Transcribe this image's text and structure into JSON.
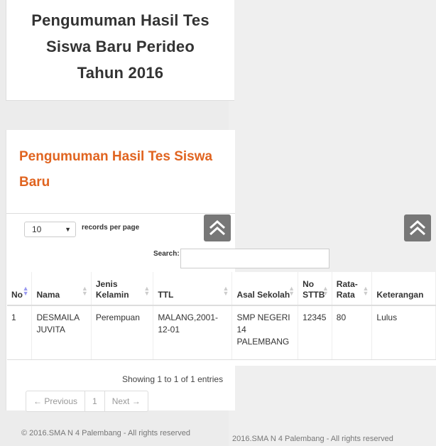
{
  "title_card": {
    "lines": [
      "Pengumuman Hasil Tes",
      "Siswa Baru Perideo",
      "Tahun 2016"
    ]
  },
  "main": {
    "heading_lines": [
      "Pengumuman Hasil Tes Siswa",
      "Baru"
    ],
    "records": {
      "value": "10",
      "label": "records per page"
    },
    "search_label": "Search:",
    "table": {
      "columns": [
        "No",
        "Nama",
        "Jenis Kelamin",
        "TTL",
        "Asal Sekolah",
        "No STTB",
        "Rata-Rata",
        "Keterangan"
      ],
      "rows": [
        [
          "1",
          "DESMAILA JUVITA",
          "Perempuan",
          "MALANG,2001-12-01",
          "SMP NEGERI 14 PALEMBANG",
          "12345",
          "80",
          "Lulus"
        ]
      ]
    },
    "info": "Showing 1 to 1 of 1 entries",
    "pager": {
      "previous": "← Previous",
      "page": "1",
      "next": "Next →"
    }
  },
  "footer": {
    "left": "© 2016.SMA N 4 Palembang - All rights reserved",
    "right": "2016.SMA N 4 Palembang - All rights reserved"
  },
  "icons": {
    "scroll_top": "double-chevron-up-icon"
  }
}
